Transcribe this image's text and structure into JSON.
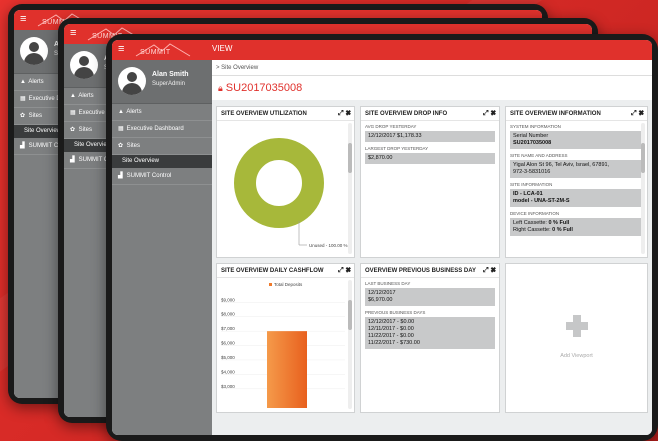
{
  "app": {
    "brand": "SUMMIT",
    "view_title": "VIEW",
    "menu_icon": "hamburger-icon"
  },
  "user": {
    "name": "Alan Smith",
    "role": "SuperAdmin",
    "name_short": "Alan",
    "role_short": "Sup"
  },
  "nav": [
    {
      "label": "Alerts",
      "icon": "warning-icon"
    },
    {
      "label": "Executive Dashboard",
      "icon": "dashboard-icon"
    },
    {
      "label": "Sites",
      "icon": "sites-icon"
    },
    {
      "label": "Site Overview",
      "icon": ""
    },
    {
      "label": "SUMMIT Control",
      "icon": "control-icon"
    }
  ],
  "nav_short": {
    "exec1": "Executive D",
    "exec2": "Executive Das",
    "ctrl1": "SUMMIT Co",
    "ctrl2": "SUMMIT Contr"
  },
  "breadcrumb": "> Site Overview",
  "site_id": "SU2017035008",
  "panels": {
    "utilization": {
      "title": "SITE OVERVIEW UTILIZATION",
      "legend": "Unused - 100.00 %",
      "unused_percent": 100
    },
    "drop": {
      "title": "SITE OVERVIEW DROP INFO",
      "avg_label": "AVG DROP YESTERDAY",
      "avg_value": "12/12/2017 $1,178.33",
      "largest_label": "LARGEST DROP YESTERDAY",
      "largest_value": "$2,870.00"
    },
    "info": {
      "title": "SITE OVERVIEW INFORMATION",
      "sys_label": "SYSTEM INFORMATION",
      "serial_line1": "Serial Number",
      "serial_line2": "SU2017035008",
      "addr_label": "SITE NAME AND ADDRESS",
      "addr_line1": "Yigal Alon St 96, Tel Aviv, Israel, 67891,",
      "addr_line2": "972-3-5831016",
      "site_label": "SITE INFORMATION",
      "site_line1": "ID - LCA-01",
      "site_line2": "model - UNA-ST-2M-S",
      "dev_label": "DEVICE INFORMATION",
      "dev_line1a": "Left Cassette: ",
      "dev_line1b": "0 % Full",
      "dev_line2a": "Right Cassette: ",
      "dev_line2b": "0 % Full"
    },
    "cashflow": {
      "title": "SITE OVERVIEW DAILY CASHFLOW"
    },
    "prev_day": {
      "title": "OVERVIEW PREVIOUS BUSINESS DAY",
      "last_label": "LAST BUSINESS DAY",
      "last_line1": "12/12/2017",
      "last_line2": "$6,970.00",
      "prev_label": "PREVIOUS BUSINESS DAYS",
      "prev_lines": [
        "12/12/2017 - $0.00",
        "12/11/2017 - $0.00",
        "11/22/2017 - $0.00",
        "11/22/2017 - $730.00"
      ]
    },
    "add_viewport": "Add Viewport"
  },
  "colors": {
    "brand_red": "#e0312c",
    "donut": "#a7b83a",
    "bar": "#f07a2b"
  },
  "chart_data": [
    {
      "type": "pie",
      "title": "",
      "categories": [
        "Unused"
      ],
      "values": [
        100.0
      ]
    },
    {
      "type": "bar",
      "title": "",
      "categories": [
        ""
      ],
      "series": [
        {
          "name": "Total Deposits",
          "values": [
            7000
          ]
        }
      ],
      "yticks": [
        "$9,000",
        "$8,000",
        "$7,000",
        "$6,000",
        "$5,000",
        "$4,000",
        "$3,000"
      ],
      "ylim": [
        2500,
        9300
      ],
      "legend": "top"
    }
  ]
}
